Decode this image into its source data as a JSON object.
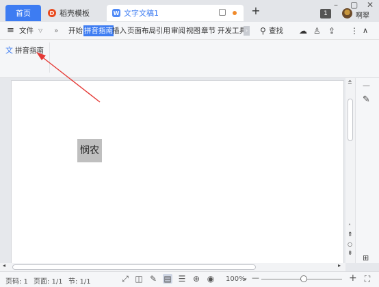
{
  "tabs": {
    "home": "首页",
    "daoke": "稻壳模板",
    "document": "文字文稿1",
    "new_tab": "+"
  },
  "window": {
    "badge": "1",
    "username": "啊翠",
    "minimize": "–",
    "maximize": "▢",
    "close": "✕"
  },
  "menubar": {
    "hamburger": "≡",
    "file": "文件",
    "more": "»",
    "items": [
      "开始",
      "拼音指南",
      "插入",
      "页面布局",
      "引用",
      "审阅",
      "视图",
      "章节",
      "开发工具"
    ],
    "active": "拼音指南",
    "search": "查找"
  },
  "ribbon": {
    "pinyin_guide": "拼音指南"
  },
  "document": {
    "selected_text": "悯农"
  },
  "statusbar": {
    "page_code": "页码: 1",
    "page": "页面: 1/1",
    "section": "节: 1/1",
    "zoom": "100%",
    "zoom_minus": "—",
    "zoom_plus": "+"
  },
  "colors": {
    "accent": "#3d7cf2",
    "arrow": "#e53935",
    "highlight": "#bfbfbf"
  }
}
